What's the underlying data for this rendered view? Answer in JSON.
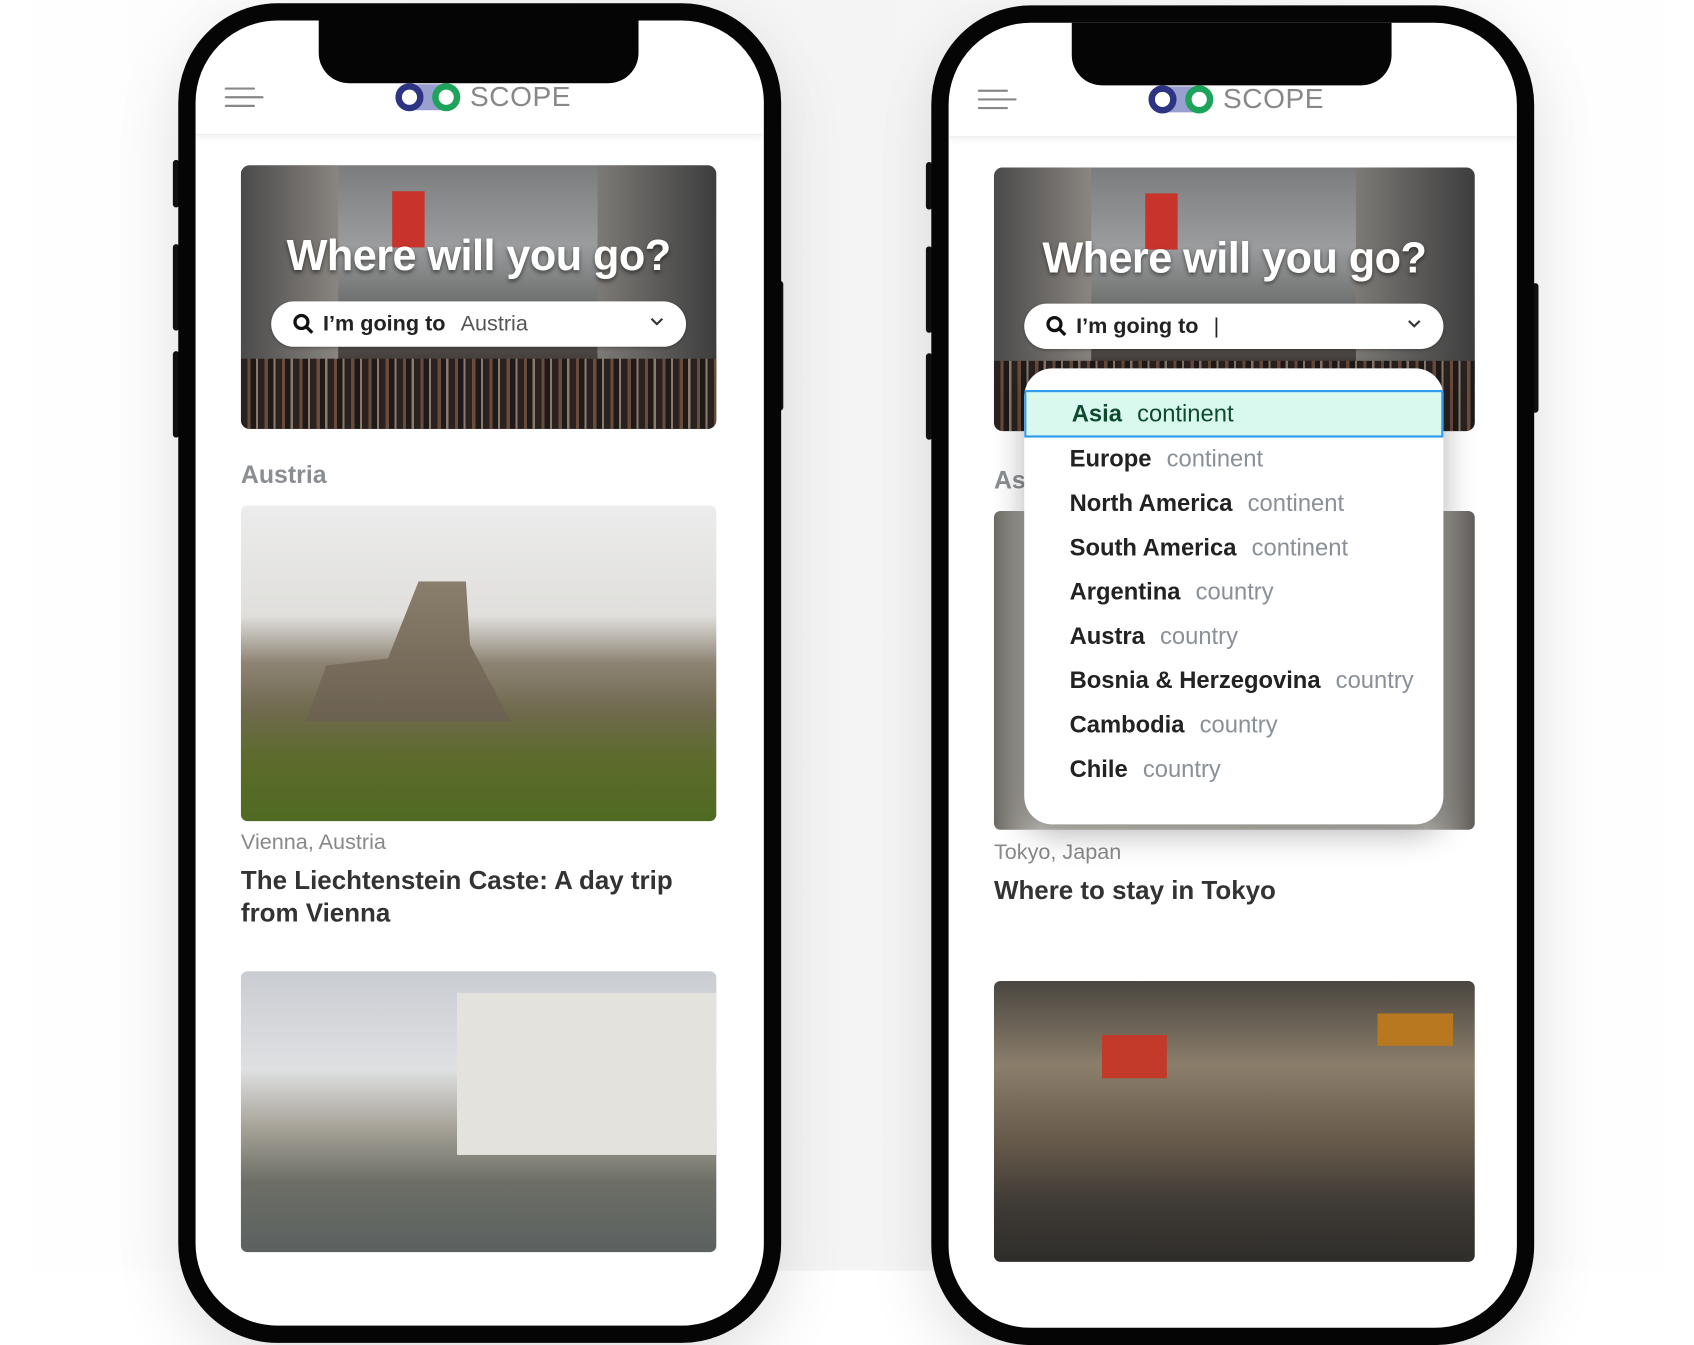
{
  "brand": {
    "name": "SCOPE",
    "colors": {
      "ring_left": "#2c3483",
      "ring_right": "#1ea35a"
    }
  },
  "left": {
    "hero_title": "Where will you go?",
    "search": {
      "label": "I’m going to",
      "value": "Austria"
    },
    "section": "Austria",
    "cards": [
      {
        "location": "Vienna, Austria",
        "title": "The Liechtenstein Caste: A day trip from Vienna"
      }
    ]
  },
  "right": {
    "hero_title": "Where will you go?",
    "search": {
      "label": "I’m going to",
      "value": "|"
    },
    "section": "As",
    "cards": [
      {
        "location": "Tokyo, Japan",
        "title": "Where to stay in Tokyo"
      }
    ],
    "options": [
      {
        "name": "Asia",
        "type": "continent",
        "selected": true
      },
      {
        "name": "Europe",
        "type": "continent"
      },
      {
        "name": "North America",
        "type": "continent"
      },
      {
        "name": "South America",
        "type": "continent"
      },
      {
        "name": "Argentina",
        "type": "country"
      },
      {
        "name": "Austra",
        "type": "country"
      },
      {
        "name": "Bosnia & Herzegovina",
        "type": "country"
      },
      {
        "name": "Cambodia",
        "type": "country"
      },
      {
        "name": "Chile",
        "type": "country"
      }
    ]
  }
}
